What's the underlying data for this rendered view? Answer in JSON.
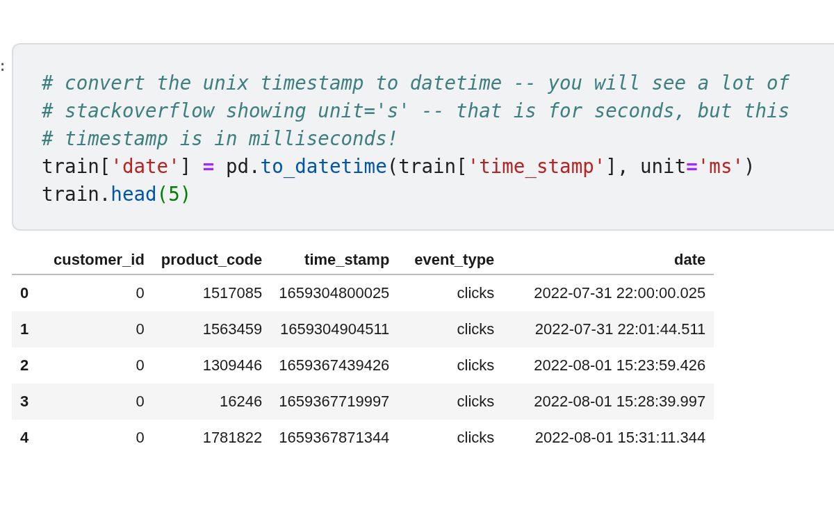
{
  "prompt": ":",
  "code_lines": [
    [
      {
        "kind": "comment",
        "text": "# convert the unix timestamp to datetime -- you will see a lot of"
      }
    ],
    [
      {
        "kind": "comment",
        "text": "# stackoverflow showing unit='s' -- that is for seconds, but this"
      }
    ],
    [
      {
        "kind": "comment",
        "text": "# timestamp is in milliseconds!"
      }
    ],
    [
      {
        "kind": "plain",
        "text": "train["
      },
      {
        "kind": "string",
        "text": "'date'"
      },
      {
        "kind": "plain",
        "text": "] "
      },
      {
        "kind": "operator",
        "text": "="
      },
      {
        "kind": "plain",
        "text": " pd."
      },
      {
        "kind": "function",
        "text": "to_datetime"
      },
      {
        "kind": "plain",
        "text": "(train["
      },
      {
        "kind": "string",
        "text": "'time_stamp'"
      },
      {
        "kind": "plain",
        "text": "], unit"
      },
      {
        "kind": "operator",
        "text": "="
      },
      {
        "kind": "string",
        "text": "'ms'"
      },
      {
        "kind": "plain",
        "text": ")"
      }
    ],
    [
      {
        "kind": "plain",
        "text": "train."
      },
      {
        "kind": "function",
        "text": "head"
      },
      {
        "kind": "number",
        "text": "(5)"
      }
    ]
  ],
  "table": {
    "columns": [
      "customer_id",
      "product_code",
      "time_stamp",
      "event_type",
      "date"
    ],
    "rows": [
      {
        "index": "0",
        "cells": [
          "0",
          "1517085",
          "1659304800025",
          "clicks",
          "2022-07-31 22:00:00.025"
        ]
      },
      {
        "index": "1",
        "cells": [
          "0",
          "1563459",
          "1659304904511",
          "clicks",
          "2022-07-31 22:01:44.511"
        ]
      },
      {
        "index": "2",
        "cells": [
          "0",
          "1309446",
          "1659367439426",
          "clicks",
          "2022-08-01 15:23:59.426"
        ]
      },
      {
        "index": "3",
        "cells": [
          "0",
          "16246",
          "1659367719997",
          "clicks",
          "2022-08-01 15:28:39.997"
        ]
      },
      {
        "index": "4",
        "cells": [
          "0",
          "1781822",
          "1659367871344",
          "clicks",
          "2022-08-01 15:31:11.344"
        ]
      }
    ]
  }
}
